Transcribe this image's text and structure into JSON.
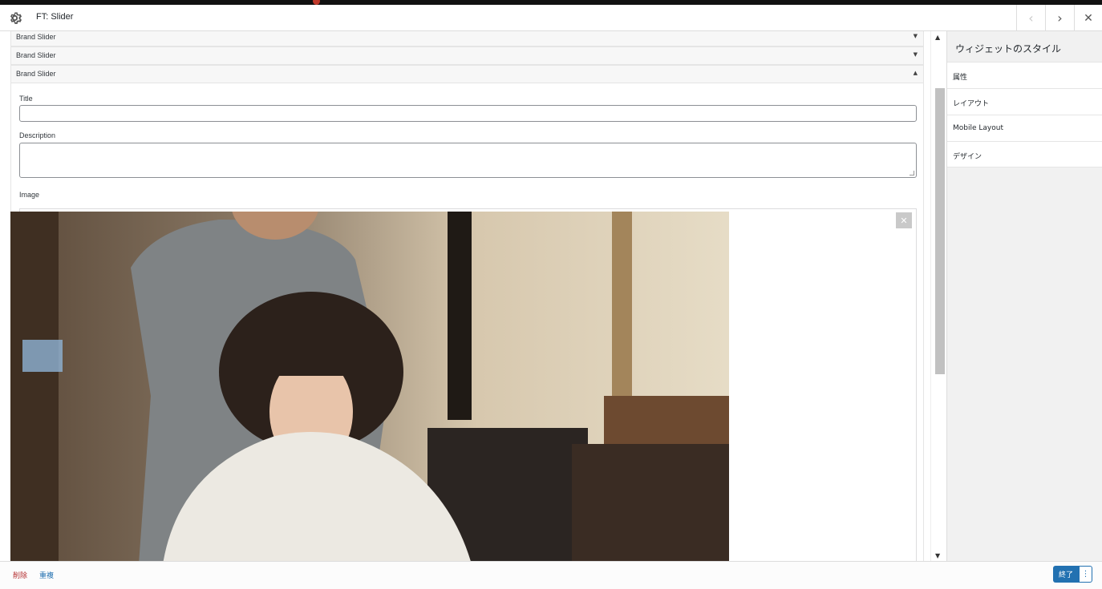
{
  "window": {
    "title": "FT: Slider",
    "prev_icon": "chevron-left-icon",
    "next_icon": "chevron-right-icon",
    "close_icon": "close-icon",
    "prev_glyph": "‹",
    "next_glyph": "›",
    "close_glyph": "✕"
  },
  "widgets": [
    {
      "label": "Brand Slider",
      "state": "collapsed",
      "arrow": "▼"
    },
    {
      "label": "Brand Slider",
      "state": "collapsed",
      "arrow": "▼"
    },
    {
      "label": "Brand Slider",
      "state": "expanded",
      "arrow": "▲"
    }
  ],
  "form": {
    "title_label": "Title",
    "title_value": "",
    "description_label": "Description",
    "description_value": "",
    "image_label": "Image",
    "image_remove_glyph": "✕"
  },
  "scrollbar": {
    "up": "▲",
    "down": "▼"
  },
  "sidebar": {
    "heading": "ウィジェットのスタイル",
    "items": [
      {
        "label": "属性"
      },
      {
        "label": "レイアウト"
      },
      {
        "label": "Mobile Layout"
      },
      {
        "label": "デザイン"
      }
    ]
  },
  "footer": {
    "delete_label": "削除",
    "duplicate_label": "重複",
    "done_label": "終了",
    "more_glyph": "⋮"
  },
  "colors": {
    "primary": "#2271b1",
    "delete": "#b32d2e"
  }
}
